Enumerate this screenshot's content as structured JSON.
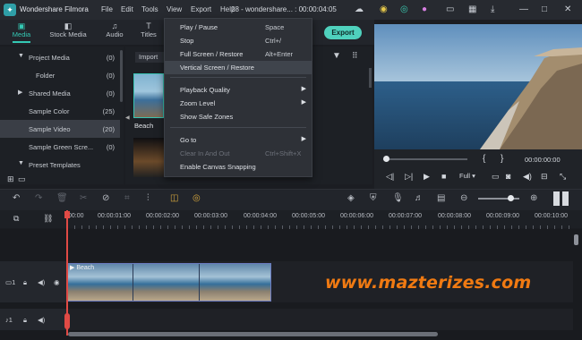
{
  "app": {
    "name": "Wondershare Filmora",
    "project_title": "28 - wondershare... : 00:00:04:05",
    "menus": [
      "File",
      "Edit",
      "Tools",
      "View",
      "Export",
      "Help"
    ]
  },
  "tabs": [
    {
      "label": "Media",
      "icon": "media-icon",
      "active": true
    },
    {
      "label": "Stock Media",
      "icon": "stock-media-icon"
    },
    {
      "label": "Audio",
      "icon": "music-note-icon"
    },
    {
      "label": "Titles",
      "icon": "title-text-icon"
    }
  ],
  "export_label": "Export",
  "sidebar": {
    "items": [
      {
        "label": "Project Media",
        "count": "(0)",
        "expand": "▼",
        "indent": 1
      },
      {
        "label": "Folder",
        "count": "(0)",
        "indent": 2
      },
      {
        "label": "Shared Media",
        "count": "(0)",
        "expand": "▶",
        "indent": 1
      },
      {
        "label": "Sample Color",
        "count": "(25)",
        "indent": 1
      },
      {
        "label": "Sample Video",
        "count": "(20)",
        "indent": 1,
        "selected": true
      },
      {
        "label": "Sample Green Scre...",
        "count": "(0)",
        "indent": 1
      },
      {
        "label": "Preset Templates",
        "count": "",
        "expand": "▼",
        "indent": 1
      }
    ]
  },
  "media": {
    "import_label": "Import",
    "thumb_label": "Beach"
  },
  "view_menu": {
    "items": [
      {
        "label": "Play / Pause",
        "shortcut": "Space"
      },
      {
        "label": "Stop",
        "shortcut": "Ctrl+/"
      },
      {
        "label": "Full Screen / Restore",
        "shortcut": "Alt+Enter"
      },
      {
        "label": "Vertical Screen / Restore",
        "shortcut": "",
        "highlighted": true
      },
      {
        "label": "Playback Quality",
        "shortcut": "",
        "submenu": true
      },
      {
        "label": "Zoom Level",
        "shortcut": "",
        "submenu": true
      },
      {
        "label": "Show Safe Zones",
        "shortcut": ""
      },
      {
        "label": "Go to",
        "shortcut": "",
        "submenu": true
      },
      {
        "label": "Clear In And Out",
        "shortcut": "Ctrl+Shift+X",
        "disabled": true
      },
      {
        "label": "Enable Canvas Snapping",
        "shortcut": ""
      }
    ]
  },
  "preview": {
    "timecode": "00:00:00:00",
    "quality": "Full",
    "brace_in": "{",
    "brace_out": "}",
    "progress": 0.0
  },
  "timeline": {
    "ruler": [
      "00:00",
      "00:00:01:00",
      "00:00:02:00",
      "00:00:03:00",
      "00:00:04:00",
      "00:00:05:00",
      "00:00:06:00",
      "00:00:07:00",
      "00:00:08:00",
      "00:00:09:00",
      "00:00:10:00"
    ],
    "clip_label": "Beach",
    "track_video_label": "1",
    "track_audio_label": "1"
  },
  "watermark": "www.mazterizes.com",
  "colors": {
    "accent": "#34c9b4",
    "export_bg": "#4fd1bd",
    "playhead": "#e04a45",
    "watermark": "#f07a12"
  }
}
